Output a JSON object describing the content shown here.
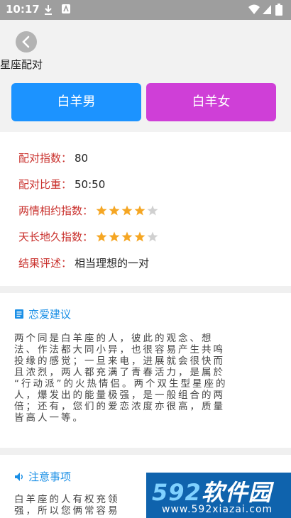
{
  "status_bar": {
    "time": "10:17",
    "icons": [
      "download-icon",
      "notification-icon",
      "wifi-icon",
      "signal-icon",
      "battery-icon"
    ]
  },
  "header": {
    "back_icon": "chevron-left-icon",
    "title": "星座配对"
  },
  "gender_buttons": {
    "male": "白羊男",
    "female": "白羊女",
    "male_color": "#1c93ff",
    "female_color": "#cf3fd7"
  },
  "result": {
    "score_label": "配对指数：",
    "score_value": "80",
    "ratio_label": "配对比重：",
    "ratio_value": "50:50",
    "love_label": "两情相约指数：",
    "love_stars": 4,
    "long_label": "天长地久指数：",
    "long_stars": 4,
    "stars_max": 5,
    "comment_label": "结果评述：",
    "comment_value": "相当理想的一对"
  },
  "sections": {
    "advice": {
      "icon": "document-icon",
      "title": "恋爱建议",
      "lines": [
        "两个同是白羊座的人，彼此的观念、想",
        "法、作法都大同小异，也很容易产生共鸣",
        "投缘的感觉；一旦来电，进展就会很快而",
        "且浓烈，两人都充满了青春活力，是属於",
        "“行动派”的火热情侣。两个双生型星座的",
        "人，爆发出的能量极强，是一般组合的两",
        "倍；还有，您们的爱恋浓度亦很高，质量",
        "皆高人一等。"
      ]
    },
    "notice": {
      "icon": "speaker-icon",
      "title": "注意事项",
      "lines": [
        "白羊座的人有权充领",
        "强，所以您俩常容易"
      ]
    }
  },
  "watermark": {
    "logo_num": "592",
    "logo_text": "软件园",
    "url": "www.592xiazai.com"
  },
  "colors": {
    "label_red": "#c9302c",
    "section_blue": "#1a8fe6",
    "star_gold": "#f5a623",
    "star_grey": "#d0d0d0"
  }
}
